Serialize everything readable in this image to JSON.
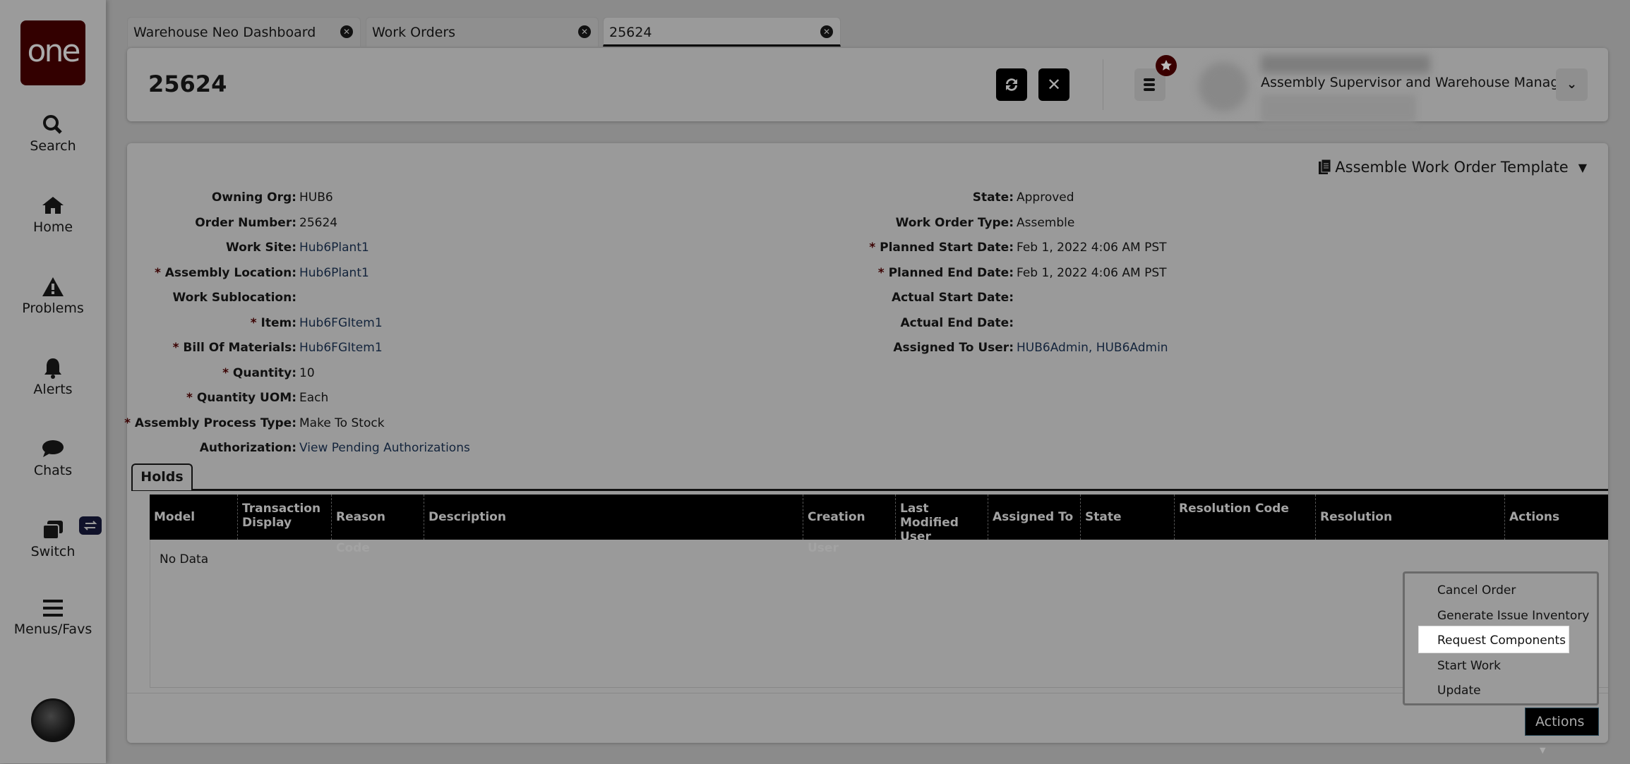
{
  "sidebar": {
    "logo": "one",
    "items": [
      {
        "label": "Search",
        "icon": "search-icon"
      },
      {
        "label": "Home",
        "icon": "home-icon"
      },
      {
        "label": "Problems",
        "icon": "warning-icon"
      },
      {
        "label": "Alerts",
        "icon": "bell-icon"
      },
      {
        "label": "Chats",
        "icon": "chat-icon"
      },
      {
        "label": "Switch",
        "icon": "switch-icon"
      },
      {
        "label": "Menus/Favs",
        "icon": "menu-icon"
      }
    ]
  },
  "tabs": [
    {
      "label": "Warehouse Neo Dashboard"
    },
    {
      "label": "Work Orders"
    },
    {
      "label": "25624",
      "active": true
    }
  ],
  "header": {
    "title": "25624",
    "user_role": "Assembly Supervisor and Warehouse Manager"
  },
  "template": {
    "label": "Assemble Work Order Template"
  },
  "fields_left": [
    {
      "label": "Owning Org:",
      "value": "HUB6",
      "required": false
    },
    {
      "label": "Order Number:",
      "value": "25624",
      "required": false
    },
    {
      "label": "Work Site:",
      "value": "Hub6Plant1",
      "required": false,
      "link": true
    },
    {
      "label": "Assembly Location:",
      "value": "Hub6Plant1",
      "required": true,
      "link": true
    },
    {
      "label": "Work Sublocation:",
      "value": "",
      "required": false
    },
    {
      "label": "Item:",
      "value": "Hub6FGItem1",
      "required": true,
      "link": true
    },
    {
      "label": "Bill Of Materials:",
      "value": "Hub6FGItem1",
      "required": true,
      "link": true
    },
    {
      "label": "Quantity:",
      "value": "10",
      "required": true
    },
    {
      "label": "Quantity UOM:",
      "value": "Each",
      "required": true
    },
    {
      "label": "Assembly Process Type:",
      "value": "Make To Stock",
      "required": true
    },
    {
      "label": "Authorization:",
      "value": "View Pending Authorizations",
      "required": false,
      "link": true
    }
  ],
  "fields_right": [
    {
      "label": "State:",
      "value": "Approved",
      "required": false
    },
    {
      "label": "Work Order Type:",
      "value": "Assemble",
      "required": false
    },
    {
      "label": "Planned Start Date:",
      "value": "Feb 1, 2022 4:06 AM PST",
      "required": true
    },
    {
      "label": "Planned End Date:",
      "value": "Feb 1, 2022 4:06 AM PST",
      "required": true
    },
    {
      "label": "Actual Start Date:",
      "value": "",
      "required": false
    },
    {
      "label": "Actual End Date:",
      "value": "",
      "required": false
    },
    {
      "label": "Assigned To User:",
      "value": "HUB6Admin, HUB6Admin",
      "required": false,
      "link": true
    }
  ],
  "holds": {
    "tab": "Holds",
    "columns": [
      "Model",
      "Transaction Display",
      "Reason Code",
      "Description",
      "Creation User",
      "Last Modified User",
      "Assigned To",
      "State",
      "Resolution Code",
      "Resolution",
      "Actions"
    ],
    "empty": "No Data"
  },
  "actions": {
    "label": "Actions",
    "menu": [
      "Cancel Order",
      "Generate Issue Inventory",
      "Request Components",
      "Start Work",
      "Update"
    ],
    "highlighted": "Request Components"
  }
}
